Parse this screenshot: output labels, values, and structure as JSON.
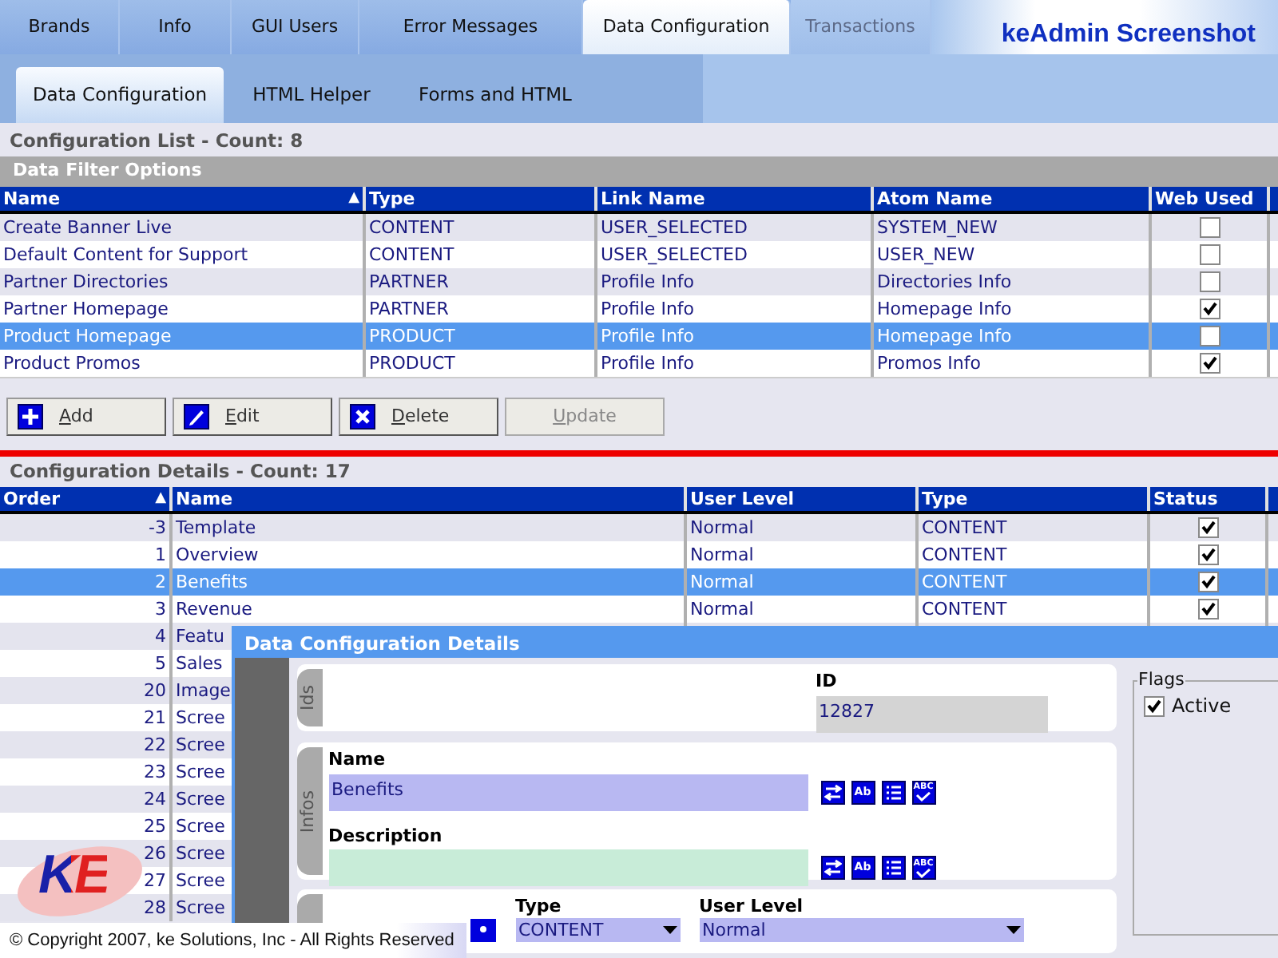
{
  "top_tabs": [
    {
      "label": "Brands",
      "selected": false,
      "disabled": false
    },
    {
      "label": "Info",
      "selected": false,
      "disabled": false
    },
    {
      "label": "GUI Users",
      "selected": false,
      "disabled": false
    },
    {
      "label": "Error Messages",
      "selected": false,
      "disabled": false
    },
    {
      "label": "Data Configuration",
      "selected": true,
      "disabled": false
    },
    {
      "label": "Transactions",
      "selected": false,
      "disabled": true
    }
  ],
  "app_title": "keAdmin Screenshot",
  "sub_tabs": [
    {
      "label": "Data Configuration",
      "selected": true
    },
    {
      "label": "HTML Helper",
      "selected": false
    },
    {
      "label": "Forms and HTML",
      "selected": false
    }
  ],
  "config_list": {
    "title": "Configuration List - Count: 8",
    "filter_title": "Data Filter Options",
    "columns": [
      {
        "label": "Name",
        "sort_glyph": "▲"
      },
      {
        "label": "Type"
      },
      {
        "label": "Link Name"
      },
      {
        "label": "Atom Name"
      },
      {
        "label": "Web Used"
      }
    ],
    "rows": [
      {
        "name": "Create Banner Live",
        "type": "CONTENT",
        "link_name": "USER_SELECTED",
        "atom_name": "SYSTEM_NEW",
        "web_used": false,
        "selected": false
      },
      {
        "name": "Default Content for Support",
        "type": "CONTENT",
        "link_name": "USER_SELECTED",
        "atom_name": "USER_NEW",
        "web_used": false,
        "selected": false
      },
      {
        "name": "Partner Directories",
        "type": "PARTNER",
        "link_name": "Profile Info",
        "atom_name": "Directories Info",
        "web_used": false,
        "selected": false
      },
      {
        "name": "Partner Homepage",
        "type": "PARTNER",
        "link_name": "Profile Info",
        "atom_name": "Homepage Info",
        "web_used": true,
        "selected": false
      },
      {
        "name": "Product Homepage",
        "type": "PRODUCT",
        "link_name": "Profile Info",
        "atom_name": "Homepage Info",
        "web_used": false,
        "selected": true
      },
      {
        "name": "Product Promos",
        "type": "PRODUCT",
        "link_name": "Profile Info",
        "atom_name": "Promos Info",
        "web_used": true,
        "selected": false
      }
    ]
  },
  "buttons": [
    {
      "label": "Add",
      "kind": "add",
      "disabled": false
    },
    {
      "label": "Edit",
      "kind": "edit",
      "disabled": false
    },
    {
      "label": "Delete",
      "kind": "delete",
      "disabled": false
    },
    {
      "label": "Update",
      "kind": "plain",
      "disabled": true
    }
  ],
  "config_details": {
    "title": "Configuration Details - Count: 17",
    "columns": [
      {
        "label": "Order",
        "sort_glyph": "▲"
      },
      {
        "label": "Name"
      },
      {
        "label": "User Level"
      },
      {
        "label": "Type"
      },
      {
        "label": "Status"
      }
    ],
    "rows": [
      {
        "order": "-3",
        "name": "Template",
        "user_level": "Normal",
        "type": "CONTENT",
        "status": true,
        "selected": false
      },
      {
        "order": "1",
        "name": "Overview",
        "user_level": "Normal",
        "type": "CONTENT",
        "status": true,
        "selected": false
      },
      {
        "order": "2",
        "name": "Benefits",
        "user_level": "Normal",
        "type": "CONTENT",
        "status": true,
        "selected": true
      },
      {
        "order": "3",
        "name": "Revenue",
        "user_level": "Normal",
        "type": "CONTENT",
        "status": true,
        "selected": false
      },
      {
        "order": "4",
        "name": "Featu",
        "selected": false
      },
      {
        "order": "5",
        "name": "Sales",
        "selected": false
      },
      {
        "order": "20",
        "name": "Image",
        "selected": false
      },
      {
        "order": "21",
        "name": "Scree",
        "selected": false
      },
      {
        "order": "22",
        "name": "Scree",
        "selected": false
      },
      {
        "order": "23",
        "name": "Scree",
        "selected": false
      },
      {
        "order": "24",
        "name": "Scree",
        "selected": false
      },
      {
        "order": "25",
        "name": "Scree",
        "selected": false
      },
      {
        "order": "26",
        "name": "Scree",
        "selected": false
      },
      {
        "order": "27",
        "name": "Scree",
        "selected": false
      },
      {
        "order": "28",
        "name": "Scree",
        "selected": false
      }
    ]
  },
  "dialog": {
    "title": "Data Configuration Details",
    "ids_label": "Ids",
    "id_label": "ID",
    "id_value": "12827",
    "infos_label": "Infos",
    "name_field": {
      "label": "Name",
      "value": "Benefits",
      "tools": [
        {
          "kind": "swap"
        },
        {
          "kind": "text",
          "label": "Ab"
        },
        {
          "kind": "list"
        },
        {
          "kind": "spell",
          "label": "ABC"
        }
      ]
    },
    "description_field": {
      "label": "Description",
      "tools": [
        {
          "kind": "swap"
        },
        {
          "kind": "text",
          "label": "Ab"
        },
        {
          "kind": "list"
        },
        {
          "kind": "spell",
          "label": "ABC"
        }
      ]
    },
    "type_label": "Type",
    "type_value": "CONTENT",
    "user_level_label": "User Level",
    "user_level_value": "Normal",
    "flags_label": "Flags",
    "flags": [
      {
        "label": "Active",
        "checked": true
      }
    ]
  },
  "logo": "KE",
  "copyright": "© Copyright 2007, ke Solutions, Inc - All Rights Reserved"
}
